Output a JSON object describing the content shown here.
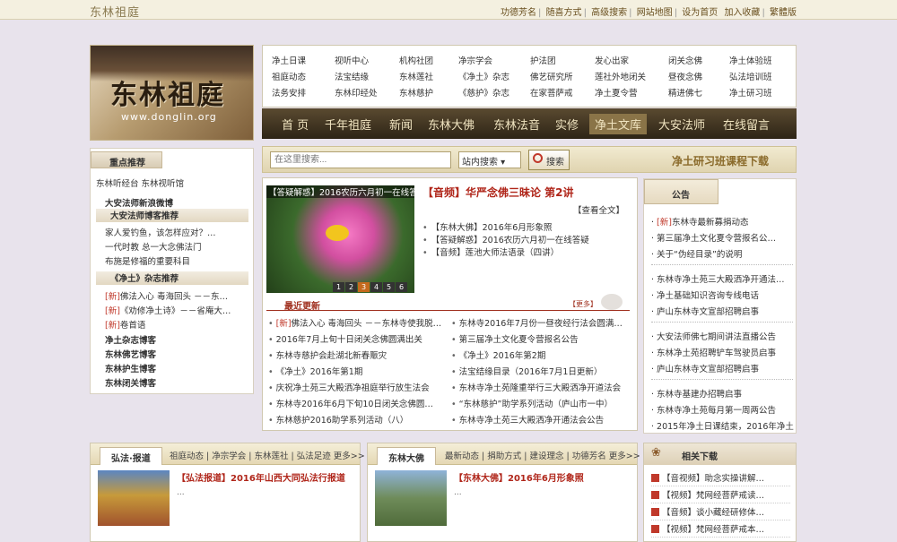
{
  "header": {
    "logo_text": "东林祖庭",
    "links": [
      "功德芳名",
      "随喜方式",
      "高级搜索",
      "网站地图",
      "设为首页",
      "加入收藏",
      "繁體版"
    ]
  },
  "logo": {
    "title": "东林祖庭",
    "url": "www.donglin.org"
  },
  "nav_grid": [
    [
      "净土日课",
      "祖庭动态",
      "法务安排"
    ],
    [
      "视听中心",
      "法宝结缘",
      "东林印经处"
    ],
    [
      "机构社团",
      "东林莲社",
      "东林慈护"
    ],
    [
      "净宗学会",
      "《净土》杂志",
      "《慈护》杂志"
    ],
    [
      "护法团",
      "佛艺研究所",
      "在家菩萨戒"
    ],
    [
      "发心出家",
      "莲社外地闭关",
      "净土夏令营"
    ],
    [
      "闭关念佛",
      "昼夜念佛",
      "精进佛七"
    ],
    [
      "净土体验班",
      "弘法培训班",
      "净土研习班"
    ]
  ],
  "main_nav": [
    "首 页",
    "千年祖庭",
    "新闻",
    "东林大佛",
    "东林法音",
    "实修",
    "净土文库",
    "大安法师",
    "在线留言"
  ],
  "main_nav_active": "净土文库",
  "search": {
    "placeholder": "在这里搜索...",
    "scope": "站内搜索",
    "button": "搜索",
    "course_download": "净土研习班课程下载"
  },
  "left": {
    "tab": "重点推荐",
    "top_link": "东林听经台 东林视听馆",
    "items1": [
      "大安法师新浪微博",
      "大安法师博客推荐"
    ],
    "items2": [
      "家人爱钓鱼，该怎样应对？…",
      "一代时教 总一大念佛法门",
      "布施是修福的重要科目"
    ],
    "magazine_hd": "《净土》杂志推荐",
    "mag_items": [
      {
        "tag": "[新]",
        "text": "佛法入心 毒海回头 －－东…"
      },
      {
        "tag": "[新]",
        "text": "《劝修净土诗》－－省庵大…"
      },
      {
        "tag": "[新]",
        "text": "卷首语"
      }
    ],
    "blogs": [
      "净土杂志博客",
      "东林佛艺博客",
      "东林护生博客",
      "东林闭关博客"
    ]
  },
  "center": {
    "slide_caption": "【答疑解惑】2016农历六月初一在线答疑",
    "slide_dots": [
      "1",
      "2",
      "3",
      "4",
      "5",
      "6"
    ],
    "slide_active": "3",
    "feature_title": "【音频】华严念佛三昧论 第2讲",
    "view_all": "【查看全文】",
    "feature_links": [
      "【东林大佛】2016年6月形象照",
      "【答疑解惑】2016农历六月初一在线答疑",
      "【音频】莲池大师法语录（四讲）"
    ],
    "latest_title": "最近更新",
    "latest_more": "【更多】",
    "latest_left": [
      {
        "tag": "[新]",
        "text": "佛法入心 毒海回头 －－东林寺使我脱…"
      },
      {
        "tag": "",
        "text": "2016年7月上旬十日闭关念佛圆满出关"
      },
      {
        "tag": "",
        "text": "东林寺慈护会赴湖北新春赈灾"
      },
      {
        "tag": "",
        "text": "《净土》2016年第1期"
      },
      {
        "tag": "",
        "text": "庆祝净土苑三大殿洒净祖庭举行放生法会"
      },
      {
        "tag": "",
        "text": "东林寺2016年6月下旬10日闭关念佛圆…"
      },
      {
        "tag": "",
        "text": "东林慈护2016助学系列活动（八）"
      }
    ],
    "latest_right": [
      "东林寺2016年7月份一昼夜经行法会圆满…",
      "第三届净土文化夏令营报名公告",
      "《净土》2016年第2期",
      "法宝结缘目录（2016年7月1日更新）",
      "东林寺净土苑隆重举行三大殿洒净开道法会",
      "“东林慈护”助学系列活动（庐山市一中）",
      "东林寺净土苑三大殿洒净开通法会公告"
    ]
  },
  "announcement": {
    "tab": "公告",
    "group1": [
      {
        "tag": "[新]",
        "text": "东林寺最新募捐动态"
      },
      {
        "tag": "",
        "text": "第三届净土文化夏令营报名公…"
      },
      {
        "tag": "",
        "text": "关于“伪经目录”的说明"
      }
    ],
    "group2": [
      "东林寺净土苑三大殿洒净开通法…",
      "净土基础知识咨询专线电话",
      "庐山东林寺文宣部招聘启事"
    ],
    "group3": [
      "大安法师佛七期间讲法直播公告",
      "东林净土苑招聘铲车驾驶员启事",
      "庐山东林寺文宣部招聘启事"
    ],
    "group4": [
      "东林寺基建办招聘启事",
      "东林寺净土苑每月第一周两公告",
      "2015年净土日课结束，2016年净土"
    ]
  },
  "bottom_left": {
    "tab": "弘法·报道",
    "links": "祖庭动态 | 净宗学会 | 东林莲社 | 弘法足迹  更多>>",
    "title": "【弘法报道】2016年山西大同弘法行报道",
    "dots": "..."
  },
  "bottom_mid": {
    "tab": "东林大佛",
    "links": "最新动态 | 捐助方式 | 建设理念 | 功德芳名  更多>>",
    "title": "【东林大佛】2016年6月形象照",
    "dots": "..."
  },
  "downloads": {
    "title": "相关下载",
    "items": [
      "【音视频】助念实操讲解…",
      "【视频】梵网经菩萨戒读…",
      "【音频】谈小藏经研修体…",
      "【视频】梵网经菩萨戒本…"
    ]
  },
  "colors": {
    "accent": "#b0261a",
    "nav_bg": "#2d2416",
    "page_bg": "#e8e3ec"
  }
}
